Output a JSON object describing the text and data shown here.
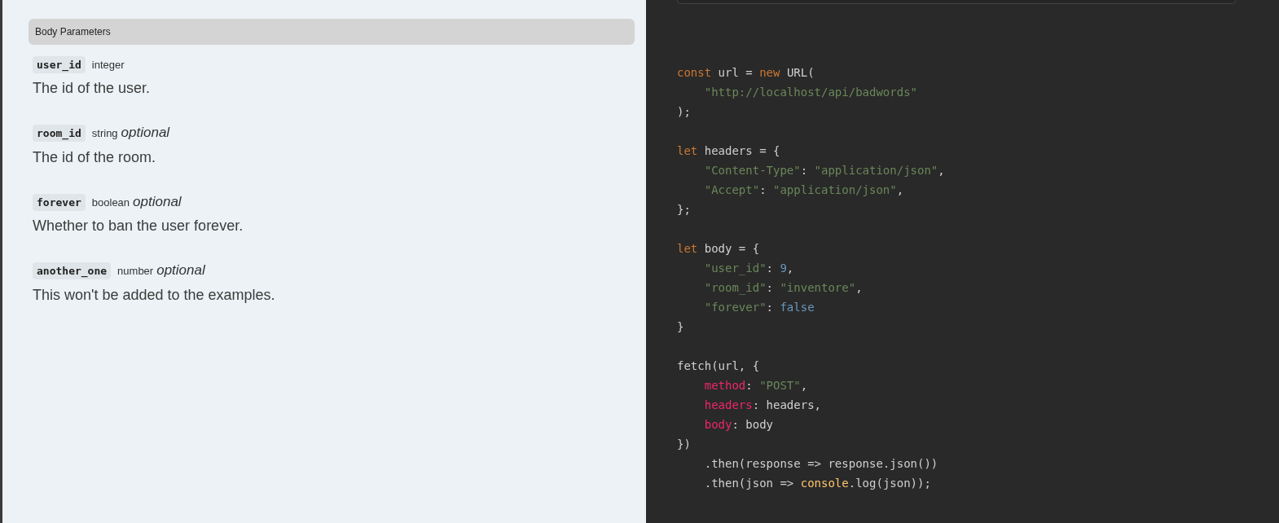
{
  "section": {
    "title": "Body Parameters"
  },
  "parameters": [
    {
      "name": "user_id",
      "type": "integer",
      "description": "The id of the user."
    },
    {
      "name": "room_id",
      "type": "string",
      "optional_label": "optional",
      "description": "The id of the room."
    },
    {
      "name": "forever",
      "type": "boolean",
      "optional_label": "optional",
      "description": "Whether to ban the user forever."
    },
    {
      "name": "another_one",
      "type": "number",
      "optional_label": "optional",
      "description": "This won't be added to the examples."
    }
  ],
  "code": {
    "lines": [
      {
        "kind": "code",
        "indent": false,
        "tokens": [
          {
            "kind": "keyword",
            "text": "const"
          },
          {
            "kind": "plain",
            "text": " url = "
          },
          {
            "kind": "keyword",
            "text": "new"
          },
          {
            "kind": "plain",
            "text": " URL("
          }
        ]
      },
      {
        "kind": "code",
        "indent": true,
        "tokens": [
          {
            "kind": "string",
            "text": "\"http://localhost/api/badwords\""
          }
        ]
      },
      {
        "kind": "code",
        "indent": false,
        "tokens": [
          {
            "kind": "plain",
            "text": ");"
          }
        ]
      },
      {
        "kind": "blank"
      },
      {
        "kind": "code",
        "indent": false,
        "tokens": [
          {
            "kind": "keyword",
            "text": "let"
          },
          {
            "kind": "plain",
            "text": " headers = {"
          }
        ]
      },
      {
        "kind": "code",
        "indent": true,
        "tokens": [
          {
            "kind": "string",
            "text": "\"Content-Type\""
          },
          {
            "kind": "plain",
            "text": ": "
          },
          {
            "kind": "string",
            "text": "\"application/json\""
          },
          {
            "kind": "plain",
            "text": ","
          }
        ]
      },
      {
        "kind": "code",
        "indent": true,
        "tokens": [
          {
            "kind": "string",
            "text": "\"Accept\""
          },
          {
            "kind": "plain",
            "text": ": "
          },
          {
            "kind": "string",
            "text": "\"application/json\""
          },
          {
            "kind": "plain",
            "text": ","
          }
        ]
      },
      {
        "kind": "code",
        "indent": false,
        "tokens": [
          {
            "kind": "plain",
            "text": "};"
          }
        ]
      },
      {
        "kind": "blank"
      },
      {
        "kind": "code",
        "indent": false,
        "tokens": [
          {
            "kind": "keyword",
            "text": "let"
          },
          {
            "kind": "plain",
            "text": " body = {"
          }
        ]
      },
      {
        "kind": "code",
        "indent": true,
        "tokens": [
          {
            "kind": "string",
            "text": "\"user_id\""
          },
          {
            "kind": "plain",
            "text": ": "
          },
          {
            "kind": "literal",
            "text": "9"
          },
          {
            "kind": "plain",
            "text": ","
          }
        ]
      },
      {
        "kind": "code",
        "indent": true,
        "tokens": [
          {
            "kind": "string",
            "text": "\"room_id\""
          },
          {
            "kind": "plain",
            "text": ": "
          },
          {
            "kind": "string",
            "text": "\"inventore\""
          },
          {
            "kind": "plain",
            "text": ","
          }
        ]
      },
      {
        "kind": "code",
        "indent": true,
        "tokens": [
          {
            "kind": "string",
            "text": "\"forever\""
          },
          {
            "kind": "plain",
            "text": ": "
          },
          {
            "kind": "literal",
            "text": "false"
          }
        ]
      },
      {
        "kind": "code",
        "indent": false,
        "tokens": [
          {
            "kind": "plain",
            "text": "}"
          }
        ]
      },
      {
        "kind": "blank"
      },
      {
        "kind": "code",
        "indent": false,
        "tokens": [
          {
            "kind": "plain",
            "text": "fetch(url, {"
          }
        ]
      },
      {
        "kind": "code",
        "indent": true,
        "tokens": [
          {
            "kind": "property",
            "text": "method"
          },
          {
            "kind": "plain",
            "text": ": "
          },
          {
            "kind": "string",
            "text": "\"POST\""
          },
          {
            "kind": "plain",
            "text": ","
          }
        ]
      },
      {
        "kind": "code",
        "indent": true,
        "tokens": [
          {
            "kind": "property",
            "text": "headers"
          },
          {
            "kind": "plain",
            "text": ": headers,"
          }
        ]
      },
      {
        "kind": "code",
        "indent": true,
        "tokens": [
          {
            "kind": "property",
            "text": "body"
          },
          {
            "kind": "plain",
            "text": ": body"
          }
        ]
      },
      {
        "kind": "code",
        "indent": false,
        "tokens": [
          {
            "kind": "plain",
            "text": "})"
          }
        ]
      },
      {
        "kind": "code",
        "indent": true,
        "tokens": [
          {
            "kind": "plain",
            "text": ".then(response => response.json())"
          }
        ]
      },
      {
        "kind": "code",
        "indent": true,
        "tokens": [
          {
            "kind": "plain",
            "text": ".then(json => "
          },
          {
            "kind": "builtin",
            "text": "console"
          },
          {
            "kind": "plain",
            "text": ".log(json));"
          }
        ]
      }
    ]
  }
}
